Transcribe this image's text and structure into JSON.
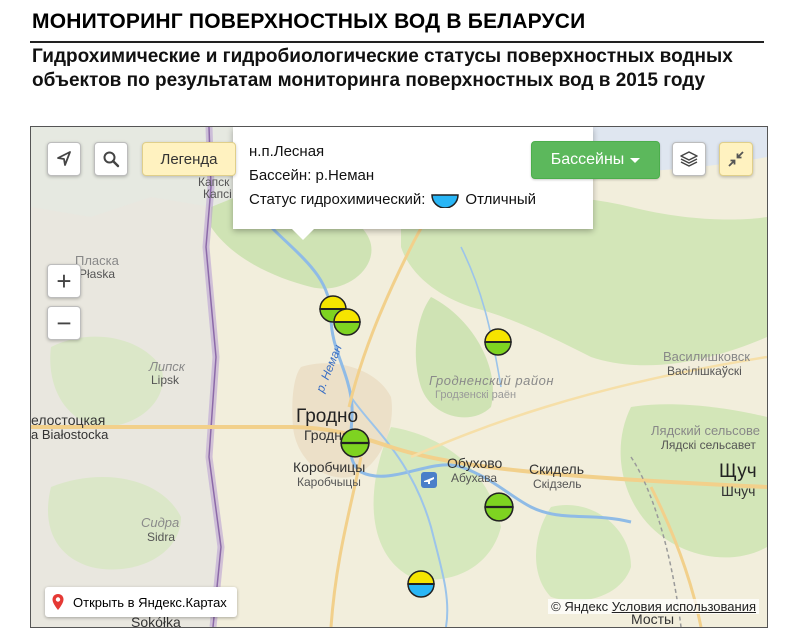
{
  "header": {
    "title": "МОНИТОРИНГ ПОВЕРХНОСТНЫХ ВОД В БЕЛАРУСИ",
    "subtitle": "Гидрохимические и гидробиологические статусы поверхностных водных объектов по результатам мониторинга поверхностных вод в 2015 году"
  },
  "map_controls": {
    "legend_label": "Легенда",
    "basins_label": "Бассейны",
    "zoom_in_label": "+",
    "zoom_out_label": "−",
    "icons": [
      "navigation-arrow-icon",
      "search-icon",
      "layers-icon",
      "fullscreen-collapse-icon",
      "zoom-in-icon",
      "zoom-out-icon",
      "map-pin-icon",
      "airport-icon"
    ]
  },
  "popup": {
    "place": "н.п.Лесная",
    "basin": "Бассейн: р.Неман",
    "status_label": "Статус гидрохимический:",
    "status_value": "Отличный"
  },
  "places": {
    "grodno": "Гродно",
    "grodno_be": "Гродна",
    "korobchitsy": "Коробчицы",
    "korobchitsy_be": "Каробчыцы",
    "obukhovo": "Обухово",
    "obukhovo_be": "Абухава",
    "skidel": "Скидель",
    "skidel_be": "Скідзель",
    "shchuchin": "Щуч",
    "shchuchin_be": "Шчуч",
    "mosty": "Мосты",
    "grodno_district": "Гродненский район",
    "grodno_district_be": "Гродзенскі раён",
    "vasilishki": "Василишковск",
    "vasilishki_be": "Васілішкаўскі",
    "lyadsky": "Лядский сельсове",
    "lyadsky_be": "Лядскі сельсавет",
    "plaska": "Пласка",
    "plaska_pl": "Płaska",
    "lipsk": "Липск",
    "lipsk_pl": "Lipsk",
    "bialystok": "елостоцкая",
    "bialystok_pl": "a Białostocka",
    "sidra": "Сидра",
    "sidra_pl": "Sidra",
    "sokolka": "Sokółka",
    "kapsk": "Капск",
    "kapsk2": "Капсі",
    "river_neman": "р. Неман"
  },
  "monitoring_points": [
    {
      "status_top": "yellow",
      "status_bottom": "green"
    },
    {
      "status_top": "yellow",
      "status_bottom": "green"
    },
    {
      "status_top": "yellow",
      "status_bottom": "green"
    },
    {
      "status_top": "green",
      "status_bottom": "green"
    },
    {
      "status_top": "green",
      "status_bottom": "green"
    },
    {
      "status_top": "yellow",
      "status_bottom": "blue"
    }
  ],
  "status_colors": {
    "blue": "#29b6f6",
    "green": "#7ed321",
    "yellow": "#f5e400"
  },
  "attribution": {
    "open_in_yandex": "Открыть в Яндекс.Картах",
    "copyright": "© Яндекс",
    "terms": "Условия использования"
  }
}
